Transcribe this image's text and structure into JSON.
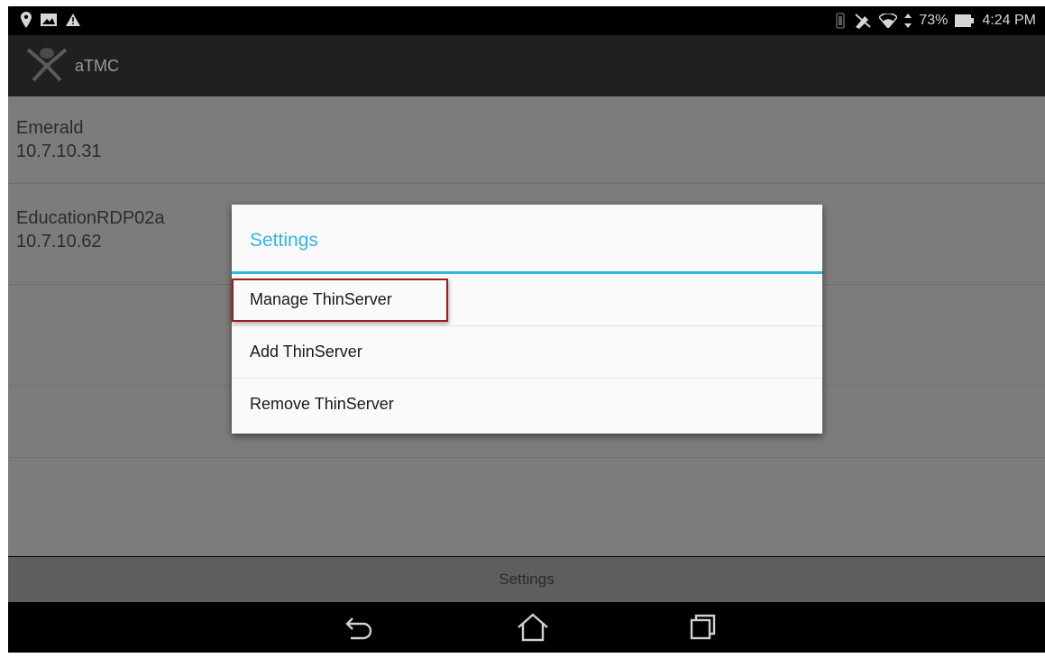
{
  "status_bar": {
    "battery_percent": "73%",
    "time": "4:24 PM"
  },
  "app": {
    "title": "aTMC"
  },
  "servers": [
    {
      "name": "Emerald",
      "ip": "10.7.10.31"
    },
    {
      "name": "EducationRDP02a",
      "ip": "10.7.10.62"
    }
  ],
  "dialog": {
    "title": "Settings",
    "items": [
      {
        "label": "Manage ThinServer",
        "highlighted": true
      },
      {
        "label": "Add ThinServer",
        "highlighted": false
      },
      {
        "label": "Remove ThinServer",
        "highlighted": false
      }
    ]
  },
  "bottom_bar": {
    "label": "Settings"
  },
  "colors": {
    "accent": "#33b5e5",
    "highlight_border": "#9b1c1c",
    "dim_background": "#7c7c7c"
  },
  "icons": {
    "status_left": [
      "location-pin-icon",
      "image-icon",
      "warning-icon"
    ],
    "status_right": [
      "vibrate-icon",
      "mute-icon",
      "wifi-icon",
      "data-arrows-icon",
      "battery-icon"
    ],
    "nav": [
      "back-icon",
      "home-icon",
      "recents-icon"
    ]
  }
}
